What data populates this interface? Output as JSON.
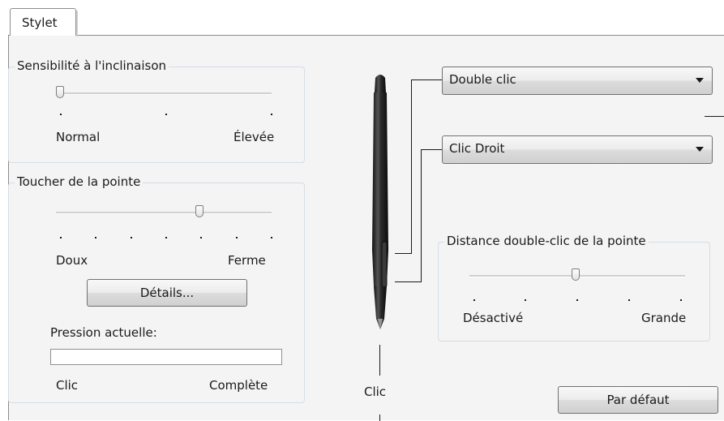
{
  "tabs": [
    {
      "label": "Stylet"
    }
  ],
  "tilt": {
    "title": "Sensibilité à l'inclinaison",
    "min_label": "Normal",
    "max_label": "Élevée",
    "level": 0.0
  },
  "tip": {
    "title": "Toucher de la pointe",
    "min_label": "Doux",
    "max_label": "Ferme",
    "level": 0.67,
    "details_button": "Détails...",
    "pressure_label": "Pression actuelle:",
    "pressure_min": "Clic",
    "pressure_max": "Complète"
  },
  "pen": {
    "upper_button": "Double clic",
    "lower_button": "Clic Droit",
    "tip_label": "Clic"
  },
  "double_click_distance": {
    "title": "Distance double-clic de la pointe",
    "min_label": "Désactivé",
    "max_label": "Grande",
    "level": 0.5
  },
  "default_button": "Par défaut"
}
